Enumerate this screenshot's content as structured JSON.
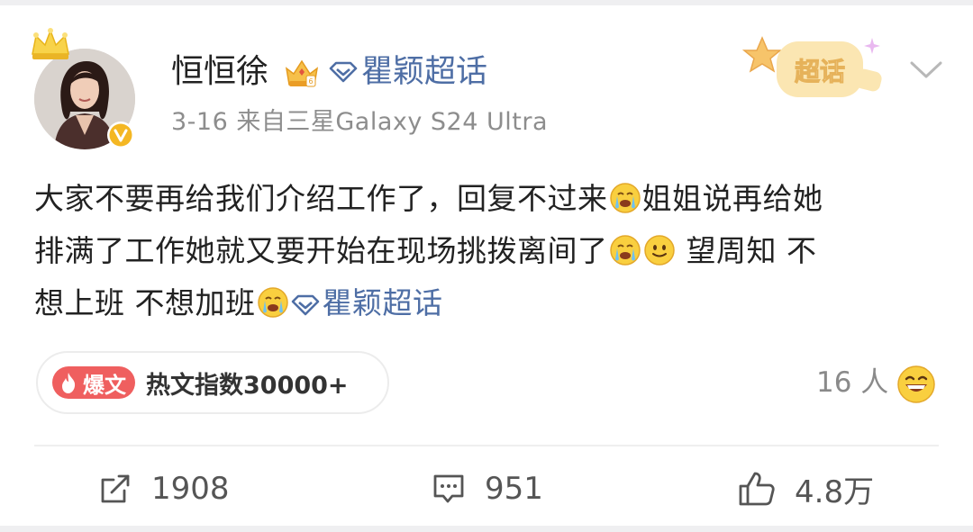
{
  "post": {
    "username": "恒恒徐",
    "topic": "瞿颖超话",
    "meta": "3-16  来自三星Galaxy S24 Ultra",
    "supertopic_badge": "超话",
    "body": {
      "line1_a": "大家不要再给我们介绍工作了，回复不过来",
      "line1_b": "姐姐说再给她",
      "line2_a": "排满了工作她就又要开始在现场挑拨离间了",
      "line2_b": " 望周知 不",
      "line3_a": "想上班 不想加班",
      "topic": "瞿颖超话"
    },
    "hot_badge": "爆文",
    "hot_text": "热文指数30000+",
    "reaction_count": "16 人",
    "actions": {
      "repost": "1908",
      "comment": "951",
      "like": "4.8万"
    },
    "icons": {
      "crown": "crown-icon",
      "verified": "verified-badge-icon",
      "vip": "vip-crown-icon",
      "diamond": "supertopic-diamond-icon",
      "chevron": "chevron-down-icon",
      "crying": "crying-emoji-icon",
      "smile": "smile-emoji-icon",
      "fire": "fire-icon",
      "grin": "grin-emoji-icon",
      "repost": "repost-icon",
      "comment": "comment-icon",
      "like": "thumbs-up-icon"
    },
    "colors": {
      "link": "#4e6ea5",
      "hot_badge": "#ef5f5f",
      "verified": "#f4b723",
      "text": "#222222",
      "muted": "#8d8d8d"
    }
  }
}
